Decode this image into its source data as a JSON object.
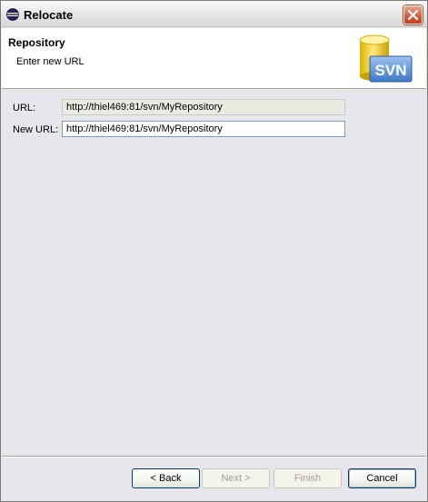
{
  "window": {
    "title": "Relocate",
    "icon": "eclipse-icon",
    "close_icon": "close-icon"
  },
  "banner": {
    "title": "Repository",
    "description": "Enter new URL",
    "logo_icon": "svn-repository-icon",
    "logo_text": "SVN"
  },
  "form": {
    "url_label": "URL:",
    "url_value": "http://thiel469:81/svn/MyRepository",
    "new_url_label": "New URL:",
    "new_url_value": "http://thiel469:81/svn/MyRepository"
  },
  "buttons": {
    "back": "< Back",
    "next": "Next >",
    "finish": "Finish",
    "cancel": "Cancel"
  }
}
